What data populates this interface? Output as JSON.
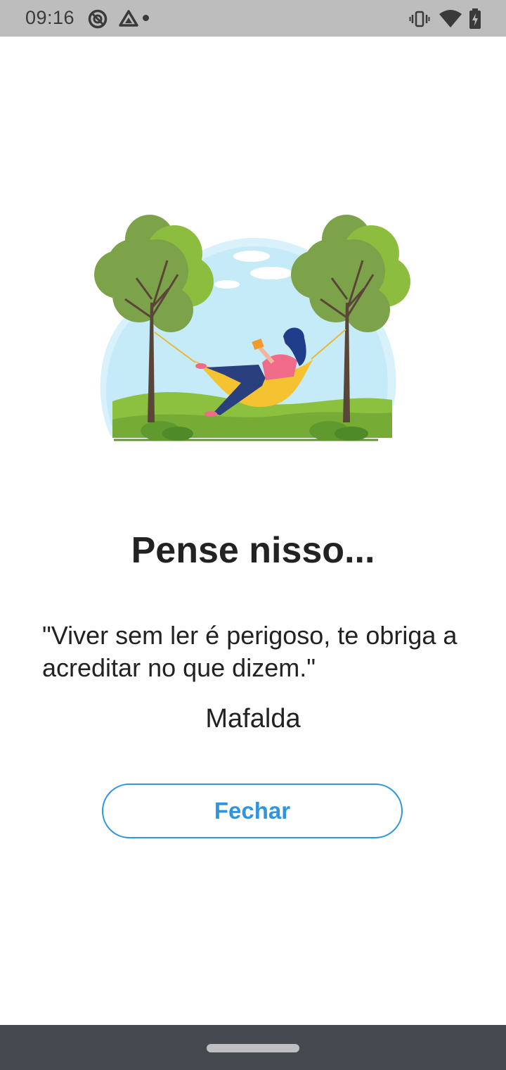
{
  "status_bar": {
    "time": "09:16",
    "icons_left": [
      "do-not-disturb-icon",
      "drive-icon"
    ],
    "icons_right": [
      "vibrate-icon",
      "wifi-icon",
      "battery-charging-icon"
    ]
  },
  "illustration": {
    "subject": "woman-reading-in-hammock-illustration"
  },
  "dialog": {
    "title": "Pense nisso...",
    "quote": "\"Viver sem ler é perigoso, te obriga a acreditar no que dizem.\"",
    "author": "Mafalda",
    "close_label": "Fechar"
  },
  "colors": {
    "accent": "#2f95e0",
    "status_bar_bg": "#bdbdbd",
    "nav_bar_bg": "#454a51",
    "text": "#222222"
  }
}
